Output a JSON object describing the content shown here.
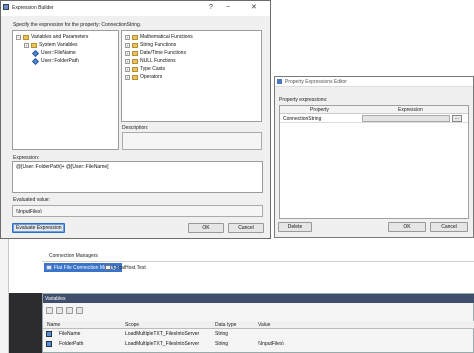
{
  "expression_builder": {
    "title": "Expression Builder",
    "description": "Specify the expression for the property: ConnectionString.",
    "variables_tree": [
      {
        "label": "Variables and Parameters",
        "expander": "−",
        "icon": "folder-icon"
      },
      {
        "label": "System Variables",
        "expander": "+",
        "icon": "folder-icon"
      },
      {
        "label": "User::FileName",
        "icon": "variable-icon"
      },
      {
        "label": "User::FolderPath",
        "icon": "variable-icon"
      }
    ],
    "functions_tree": [
      {
        "label": "Mathematical Functions",
        "expander": "+"
      },
      {
        "label": "String Functions",
        "expander": "+"
      },
      {
        "label": "Date/Time Functions",
        "expander": "+"
      },
      {
        "label": "NULL Functions",
        "expander": "+"
      },
      {
        "label": "Type Casts",
        "expander": "+"
      },
      {
        "label": "Operators",
        "expander": "+"
      }
    ],
    "description_label": "Description:",
    "expression_label": "Expression:",
    "expression_value": "@[User::FolderPath]+ @[User::FileName]",
    "evaluated_label": "Evaluated value:",
    "evaluated_value": "\\\\InputFiles\\",
    "evaluate_button": "Evaluate Expression",
    "ok_button": "OK",
    "cancel_button": "Cancel",
    "title_controls": {
      "help": "?",
      "minimize": "−",
      "close": "✕"
    }
  },
  "property_expressions_editor": {
    "title": "Property Expressions Editor",
    "label": "Property expressions:",
    "columns": [
      "Property",
      "Expression"
    ],
    "rows": [
      {
        "property": "ConnectionString",
        "expression": ""
      }
    ],
    "ellipsis_button": "...",
    "delete_button": "Delete",
    "ok_button": "OK",
    "cancel_button": "Cancel"
  },
  "connection_managers": {
    "title": "Connection Managers",
    "items": [
      "Flat File Connection Manager",
      "LocalHost.Test"
    ]
  },
  "variables_panel": {
    "title": "Variables",
    "columns": [
      "Name",
      "Scope",
      "Data type",
      "Value"
    ],
    "rows": [
      {
        "name": "FileName",
        "scope": "LoadMultipleTXT_FilesIntoServer",
        "type": "String",
        "value": ""
      },
      {
        "name": "FolderPath",
        "scope": "LoadMultipleTXT_FilesIntoServer",
        "type": "String",
        "value": "\\\\InputFiles\\"
      }
    ]
  },
  "left_strip_letters": [
    "C",
    "To",
    "S",
    "It",
    "C",
    "C"
  ],
  "colors": {
    "accent": "#2f6fc9",
    "selection": "#3a74c9",
    "folder": "#e8c260"
  }
}
